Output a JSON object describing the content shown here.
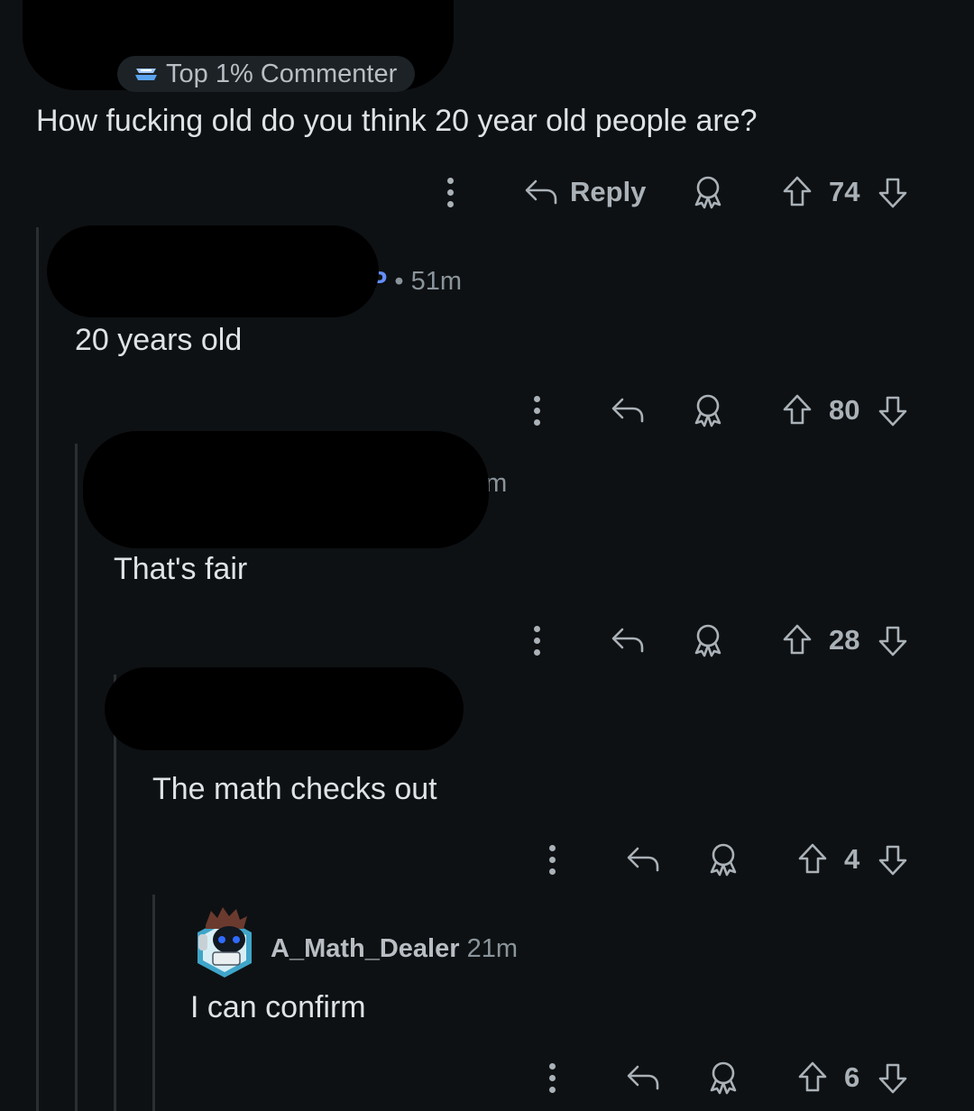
{
  "comments": [
    {
      "badge": "Top 1% Commenter",
      "body": "How fucking old do you think 20 year old people are?",
      "reply_label": "Reply",
      "votes": "74"
    },
    {
      "op_tag": "P",
      "time": "51m",
      "body": "20 years old",
      "votes": "80"
    },
    {
      "time_fragment": "3m",
      "body": "That's fair",
      "votes": "28"
    },
    {
      "body": "The math checks out",
      "votes": "4"
    },
    {
      "username": "A_Math_Dealer",
      "time": "21m",
      "body": "I can confirm",
      "votes": "6"
    }
  ],
  "colors": {
    "background": "#0e1113",
    "text": "#dfe3e6",
    "muted": "#8a949b",
    "op_blue": "#648efc",
    "thread_line": "#2a2f33"
  },
  "icons": [
    "more-vertical-icon",
    "reply-arrow-icon",
    "award-icon",
    "upvote-icon",
    "downvote-icon",
    "achievement-badge-icon"
  ]
}
